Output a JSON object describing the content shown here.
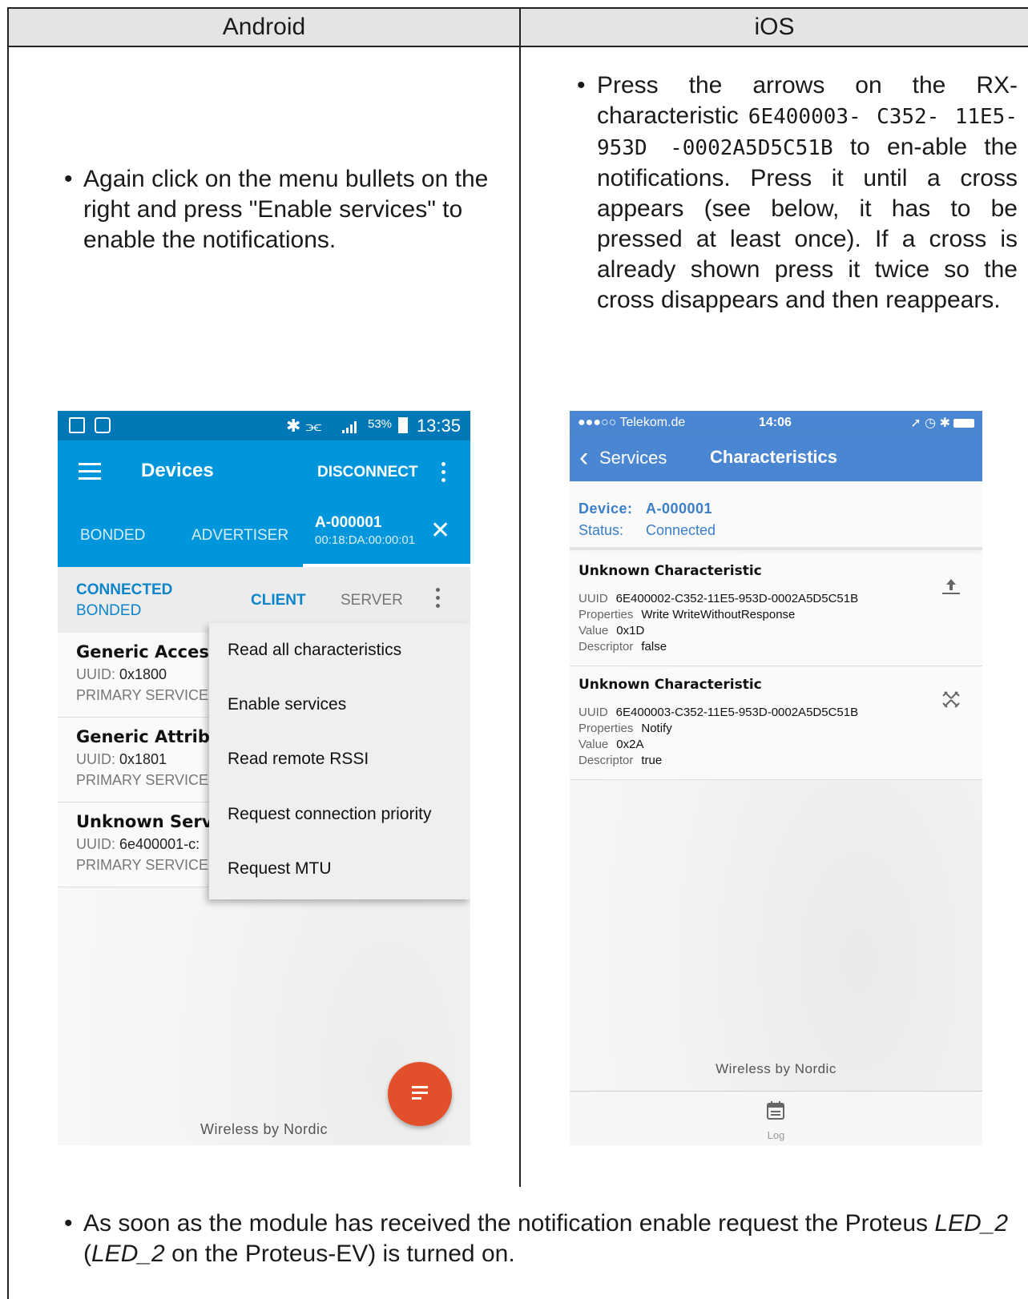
{
  "table": {
    "header_android": "Android",
    "header_ios": "iOS"
  },
  "android_instruction": "Again click on the menu bullets on the right and press \"Enable services\" to enable the notifications.",
  "ios_instruction": {
    "part1": "Press the arrows on the RX-characteristic",
    "uuid": "6E400003- C352- 11E5- 953D -0002A5D5C51B",
    "part2": "to en-able the notifications. Press it until a cross appears (see below, it has to be pressed at least once). If a cross is already shown press it twice so the cross disappears and then reappears."
  },
  "bottom_note": {
    "part1": "As soon as the module has received the notification enable request the Proteus",
    "led1": "LED_2",
    "part2": "(",
    "led2": "LED_2",
    "part3": "on the Proteus-EV) is turned on."
  },
  "android_app": {
    "status": {
      "battery": "53%",
      "time": "13:35"
    },
    "toolbar": {
      "title": "Devices",
      "disconnect": "DISCONNECT"
    },
    "tabs": {
      "bonded": "BONDED",
      "advertiser": "ADVERTISER",
      "device": "A-000001",
      "mac": "00:18:DA:00:00:01",
      "close": "✕"
    },
    "subbar": {
      "connected": "CONNECTED",
      "bonded": "BONDED",
      "client": "CLIENT",
      "server": "SERVER"
    },
    "services": [
      {
        "name": "Generic Access",
        "uuid_label": "UUID:",
        "uuid": "0x1800",
        "type": "PRIMARY SERVICE"
      },
      {
        "name": "Generic Attribu",
        "uuid_label": "UUID:",
        "uuid": "0x1801",
        "type": "PRIMARY SERVICE"
      },
      {
        "name": "Unknown Servic",
        "uuid_label": "UUID:",
        "uuid": "6e400001-c:",
        "type": "PRIMARY SERVICE"
      }
    ],
    "menu": [
      "Read all characteristics",
      "Enable services",
      "Read remote RSSI",
      "Request connection priority",
      "Request MTU"
    ],
    "footer": "Wireless by Nordic",
    "accent": "#0096dc",
    "fab_color": "#e2502b"
  },
  "ios_app": {
    "status": {
      "carrier": "●●●○○ Telekom.de",
      "time": "14:06"
    },
    "nav": {
      "back": "Services",
      "title": "Characteristics"
    },
    "info": {
      "device_label": "Device:",
      "device": "A-000001",
      "status_label": "Status:",
      "status": "Connected"
    },
    "characteristics": [
      {
        "name": "Unknown Characteristic",
        "uuid_k": "UUID",
        "uuid": "6E400002-C352-11E5-953D-0002A5D5C51B",
        "props_k": "Properties",
        "props": "Write WriteWithoutResponse",
        "value_k": "Value",
        "value": "0x1D",
        "desc_k": "Descriptor",
        "desc": "false",
        "icon": "upload-arrow-icon"
      },
      {
        "name": "Unknown Characteristic",
        "uuid_k": "UUID",
        "uuid": "6E400003-C352-11E5-953D-0002A5D5C51B",
        "props_k": "Properties",
        "props": "Notify",
        "value_k": "Value",
        "value": "0x2A",
        "desc_k": "Descriptor",
        "desc": "true",
        "icon": "notify-crossed-arrows-icon"
      }
    ],
    "footer": "Wireless by Nordic",
    "tab_log": "Log",
    "accent": "#4a86d1"
  }
}
